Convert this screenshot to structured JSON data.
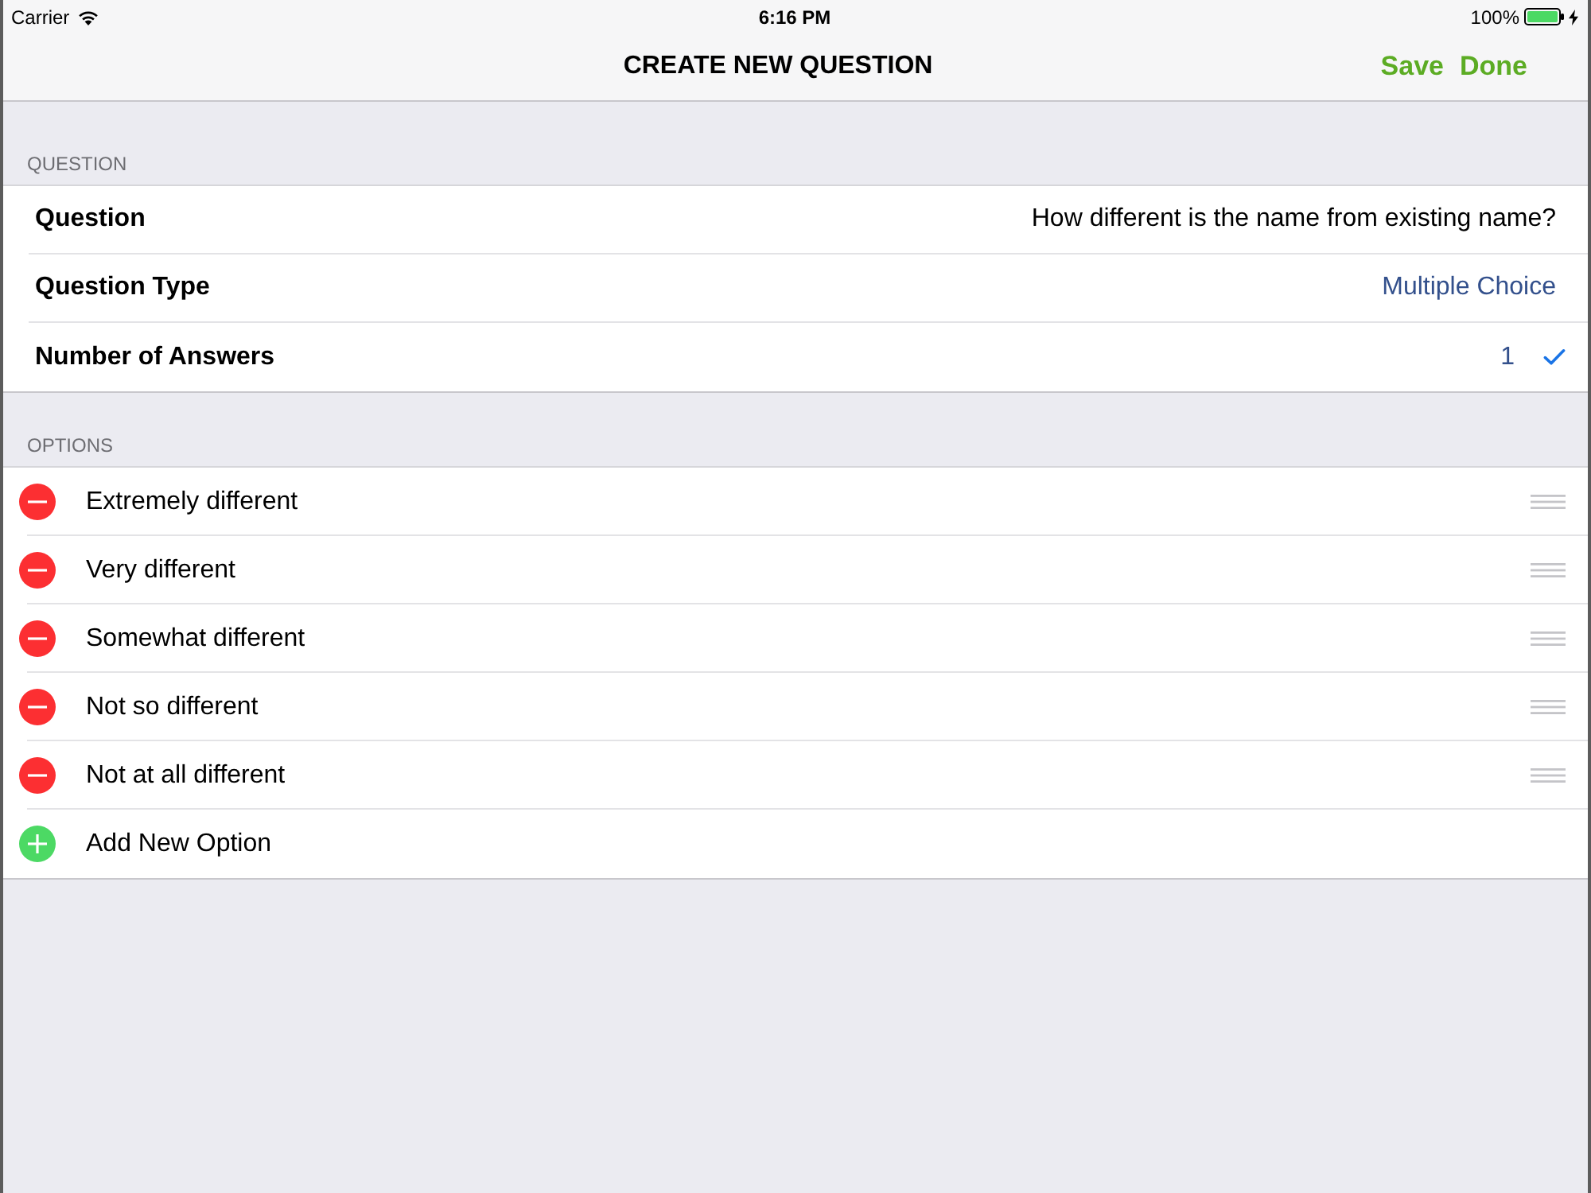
{
  "status_bar": {
    "carrier": "Carrier",
    "time": "6:16 PM",
    "battery": "100%",
    "charging": true
  },
  "nav_bar": {
    "title": "CREATE NEW QUESTION",
    "buttons": [
      "Save",
      "Done"
    ]
  },
  "question_section": {
    "header": "QUESTION",
    "rows": [
      {
        "label": "Question",
        "value": "How different is the name from existing name?",
        "kind": "text",
        "checked": false
      },
      {
        "label": "Question Type",
        "value": "Multiple Choice",
        "kind": "choice",
        "checked": false
      },
      {
        "label": "Number of Answers",
        "value": "1",
        "kind": "choice",
        "checked": true
      }
    ]
  },
  "options_section": {
    "header": "OPTIONS",
    "items": [
      {
        "label": "Extremely different",
        "kind": "remove"
      },
      {
        "label": "Very different",
        "kind": "remove"
      },
      {
        "label": "Somewhat different",
        "kind": "remove"
      },
      {
        "label": "Not so different",
        "kind": "remove"
      },
      {
        "label": "Not at all different",
        "kind": "remove"
      },
      {
        "label": "Add New Option",
        "kind": "add"
      }
    ]
  }
}
